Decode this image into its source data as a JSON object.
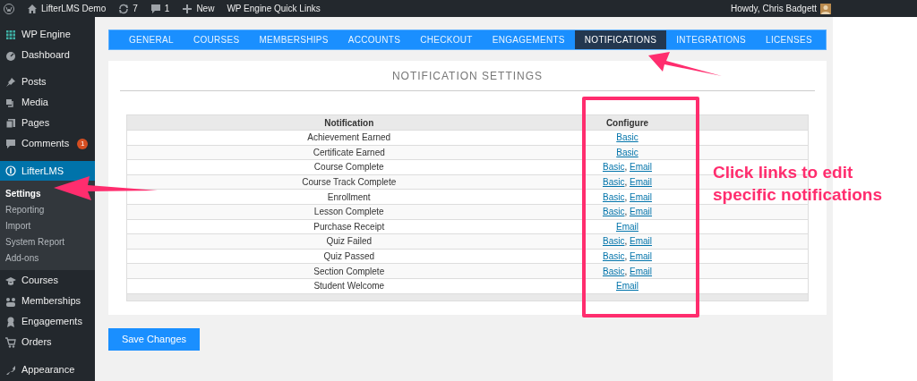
{
  "admin_bar": {
    "site": "LifterLMS Demo",
    "updates": "7",
    "comments": "1",
    "new": "New",
    "quick_links": "WP Engine Quick Links",
    "greeting": "Howdy, Chris Badgett"
  },
  "sidebar": {
    "items": [
      {
        "label": "WP Engine",
        "selected": false
      },
      {
        "label": "Dashboard",
        "selected": false
      },
      {
        "label": "Posts",
        "selected": false
      },
      {
        "label": "Media",
        "selected": false
      },
      {
        "label": "Pages",
        "selected": false
      },
      {
        "label": "Comments",
        "selected": false,
        "badge": "1"
      },
      {
        "label": "LifterLMS",
        "selected": true,
        "children": [
          {
            "label": "Settings",
            "selected": true
          },
          {
            "label": "Reporting",
            "selected": false
          },
          {
            "label": "Import",
            "selected": false
          },
          {
            "label": "System Report",
            "selected": false
          },
          {
            "label": "Add-ons",
            "selected": false
          }
        ]
      },
      {
        "label": "Courses",
        "selected": false
      },
      {
        "label": "Memberships",
        "selected": false
      },
      {
        "label": "Engagements",
        "selected": false
      },
      {
        "label": "Orders",
        "selected": false
      },
      {
        "label": "Appearance",
        "selected": false
      }
    ]
  },
  "tabs": [
    {
      "label": "GENERAL",
      "selected": false
    },
    {
      "label": "COURSES",
      "selected": false
    },
    {
      "label": "MEMBERSHIPS",
      "selected": false
    },
    {
      "label": "ACCOUNTS",
      "selected": false
    },
    {
      "label": "CHECKOUT",
      "selected": false
    },
    {
      "label": "ENGAGEMENTS",
      "selected": false
    },
    {
      "label": "NOTIFICATIONS",
      "selected": true
    },
    {
      "label": "INTEGRATIONS",
      "selected": false
    },
    {
      "label": "LICENSES",
      "selected": false
    }
  ],
  "panel": {
    "title": "NOTIFICATION SETTINGS",
    "table": {
      "columns": [
        "Notification",
        "Configure"
      ],
      "rows": [
        {
          "notification": "Achievement Earned",
          "links": [
            {
              "label": "Basic"
            }
          ]
        },
        {
          "notification": "Certificate Earned",
          "links": [
            {
              "label": "Basic"
            }
          ]
        },
        {
          "notification": "Course Complete",
          "links": [
            {
              "label": "Basic"
            },
            {
              "separator": ",",
              "label": "Email"
            }
          ]
        },
        {
          "notification": "Course Track Complete",
          "links": [
            {
              "label": "Basic"
            },
            {
              "separator": ",",
              "label": "Email"
            }
          ]
        },
        {
          "notification": "Enrollment",
          "links": [
            {
              "label": "Basic"
            },
            {
              "separator": ",",
              "label": "Email"
            }
          ]
        },
        {
          "notification": "Lesson Complete",
          "links": [
            {
              "label": "Basic"
            },
            {
              "separator": ",",
              "label": "Email"
            }
          ]
        },
        {
          "notification": "Purchase Receipt",
          "links": [
            {
              "label": "Email"
            }
          ]
        },
        {
          "notification": "Quiz Failed",
          "links": [
            {
              "label": "Basic"
            },
            {
              "separator": ",",
              "label": "Email"
            }
          ]
        },
        {
          "notification": "Quiz Passed",
          "links": [
            {
              "label": "Basic"
            },
            {
              "separator": ",",
              "label": "Email"
            }
          ]
        },
        {
          "notification": "Section Complete",
          "links": [
            {
              "label": "Basic"
            },
            {
              "separator": ",",
              "label": "Email"
            }
          ]
        },
        {
          "notification": "Student Welcome",
          "links": [
            {
              "label": "Email"
            }
          ]
        }
      ]
    }
  },
  "save_button": "Save Changes",
  "annotation": {
    "text": "Click links to edit specific notifications"
  }
}
